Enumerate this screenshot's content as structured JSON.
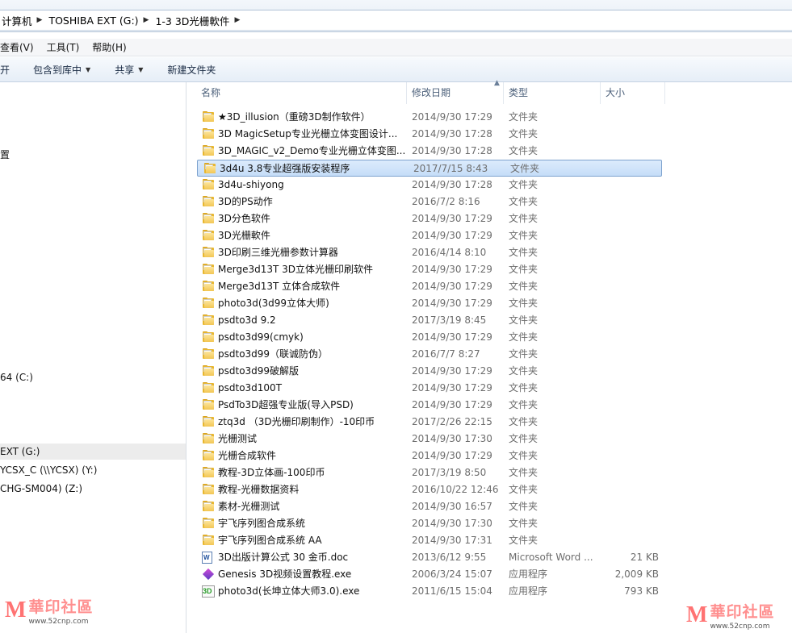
{
  "address": {
    "crumbs": [
      "计算机",
      "TOSHIBA EXT (G:)",
      "1-3 3D光栅軟件"
    ]
  },
  "menu": {
    "items": [
      "查看(V)",
      "工具(T)",
      "帮助(H)"
    ]
  },
  "toolbar": {
    "open_label": "开",
    "include_label": "包含到库中",
    "share_label": "共享",
    "new_folder_label": "新建文件夹"
  },
  "nav": {
    "items": [
      "置",
      "64 (C:)",
      "EXT (G:)",
      "YCSX_C (\\\\YCSX) (Y:)",
      "CHG-SM004) (Z:)"
    ]
  },
  "columns": {
    "name": "名称",
    "date": "修改日期",
    "type": "类型",
    "size": "大小"
  },
  "files": [
    {
      "name": "★3D_illusion（重磅3D制作软件）",
      "date": "2014/9/30 17:29",
      "type": "文件夹",
      "size": "",
      "icon": "folder-icon"
    },
    {
      "name": "3D MagicSetup专业光栅立体变图设计...",
      "date": "2014/9/30 17:28",
      "type": "文件夹",
      "size": "",
      "icon": "folder-icon"
    },
    {
      "name": "3D_MAGIC_v2_Demo专业光栅立体变图...",
      "date": "2014/9/30 17:28",
      "type": "文件夹",
      "size": "",
      "icon": "folder-icon"
    },
    {
      "name": "3d4u 3.8专业超强版安装程序",
      "date": "2017/7/15 8:43",
      "type": "文件夹",
      "size": "",
      "icon": "folder-icon"
    },
    {
      "name": "3d4u-shiyong",
      "date": "2014/9/30 17:28",
      "type": "文件夹",
      "size": "",
      "icon": "folder-icon"
    },
    {
      "name": "3D的PS动作",
      "date": "2016/7/2 8:16",
      "type": "文件夹",
      "size": "",
      "icon": "folder-icon"
    },
    {
      "name": "3D分色软件",
      "date": "2014/9/30 17:29",
      "type": "文件夹",
      "size": "",
      "icon": "folder-icon"
    },
    {
      "name": "3D光栅軟件",
      "date": "2014/9/30 17:29",
      "type": "文件夹",
      "size": "",
      "icon": "folder-icon"
    },
    {
      "name": "3D印刷三维光栅参数计算器",
      "date": "2016/4/14 8:10",
      "type": "文件夹",
      "size": "",
      "icon": "folder-icon"
    },
    {
      "name": "Merge3d13T 3D立体光栅印刷软件",
      "date": "2014/9/30 17:29",
      "type": "文件夹",
      "size": "",
      "icon": "folder-icon"
    },
    {
      "name": "Merge3d13T 立体合成软件",
      "date": "2014/9/30 17:29",
      "type": "文件夹",
      "size": "",
      "icon": "folder-icon"
    },
    {
      "name": "photo3d(3d99立体大师)",
      "date": "2014/9/30 17:29",
      "type": "文件夹",
      "size": "",
      "icon": "folder-icon"
    },
    {
      "name": "psdto3d 9.2",
      "date": "2017/3/19 8:45",
      "type": "文件夹",
      "size": "",
      "icon": "folder-icon"
    },
    {
      "name": "psdto3d99(cmyk)",
      "date": "2014/9/30 17:29",
      "type": "文件夹",
      "size": "",
      "icon": "folder-icon"
    },
    {
      "name": "psdto3d99（联诚防伪）",
      "date": "2016/7/7 8:27",
      "type": "文件夹",
      "size": "",
      "icon": "folder-icon"
    },
    {
      "name": "psdto3d99破解版",
      "date": "2014/9/30 17:29",
      "type": "文件夹",
      "size": "",
      "icon": "folder-icon"
    },
    {
      "name": "psdto3d100T",
      "date": "2014/9/30 17:29",
      "type": "文件夹",
      "size": "",
      "icon": "folder-icon"
    },
    {
      "name": "PsdTo3D超强专业版(导入PSD)",
      "date": "2014/9/30 17:29",
      "type": "文件夹",
      "size": "",
      "icon": "folder-icon"
    },
    {
      "name": "ztq3d （3D光栅印刷制作）-10印币",
      "date": "2017/2/26 22:15",
      "type": "文件夹",
      "size": "",
      "icon": "folder-icon"
    },
    {
      "name": "光栅测试",
      "date": "2014/9/30 17:30",
      "type": "文件夹",
      "size": "",
      "icon": "folder-icon"
    },
    {
      "name": "光栅合成软件",
      "date": "2014/9/30 17:29",
      "type": "文件夹",
      "size": "",
      "icon": "folder-icon"
    },
    {
      "name": "教程-3D立体画-100印币",
      "date": "2017/3/19 8:50",
      "type": "文件夹",
      "size": "",
      "icon": "folder-icon"
    },
    {
      "name": "教程-光栅数据资料",
      "date": "2016/10/22 12:46",
      "type": "文件夹",
      "size": "",
      "icon": "folder-icon"
    },
    {
      "name": "素材-光栅测试",
      "date": "2014/9/30 16:57",
      "type": "文件夹",
      "size": "",
      "icon": "folder-icon"
    },
    {
      "name": "宇飞序列图合成系统",
      "date": "2014/9/30 17:30",
      "type": "文件夹",
      "size": "",
      "icon": "folder-icon"
    },
    {
      "name": "宇飞序列图合成系统 AA",
      "date": "2014/9/30 17:31",
      "type": "文件夹",
      "size": "",
      "icon": "folder-icon"
    },
    {
      "name": "3D出版计算公式 30 金币.doc",
      "date": "2013/6/12 9:55",
      "type": "Microsoft Word ...",
      "size": "21 KB",
      "icon": "word-doc-icon"
    },
    {
      "name": "Genesis 3D视频设置教程.exe",
      "date": "2006/3/24 15:07",
      "type": "应用程序",
      "size": "2,009 KB",
      "icon": "genesis-exe-icon"
    },
    {
      "name": "photo3d(长坤立体大师3.0).exe",
      "date": "2011/6/15 15:04",
      "type": "应用程序",
      "size": "793 KB",
      "icon": "photo3d-exe-icon"
    }
  ],
  "selected_index": 3,
  "watermark": {
    "logo": "M",
    "text": "華印社區",
    "url": "www.52cnp.com",
    "color": "#ff7373"
  }
}
